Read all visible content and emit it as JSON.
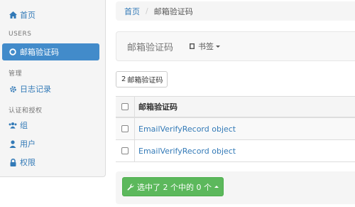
{
  "sidebar": {
    "items": [
      {
        "label": "首页",
        "icon": "home-icon"
      },
      {
        "label": "邮箱验证码",
        "icon": "circle-icon"
      },
      {
        "label": "日志记录",
        "icon": "gear-icon"
      },
      {
        "label": "组",
        "icon": "users-icon"
      },
      {
        "label": "用户",
        "icon": "user-icon"
      },
      {
        "label": "权限",
        "icon": "lock-icon"
      }
    ],
    "headers": [
      "USERS",
      "管理",
      "认证和授权"
    ]
  },
  "breadcrumb": {
    "home": "首页",
    "sep": "/",
    "current": "邮箱验证码"
  },
  "navbar": {
    "brand": "邮箱验证码",
    "bookmarks": "书签"
  },
  "count_button": {
    "count": "2",
    "label": "邮箱验证码"
  },
  "table": {
    "header": "邮箱验证码",
    "rows": [
      "EmailVerifyRecord object",
      "EmailVerifyRecord object"
    ]
  },
  "action": {
    "label": "选中了 2 个中的 0 个"
  },
  "colors": {
    "accent": "#428bca",
    "link": "#337ab7",
    "success": "#5cb85c"
  }
}
